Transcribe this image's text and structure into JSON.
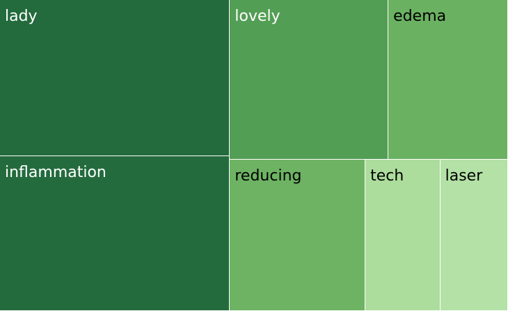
{
  "chart_data": {
    "type": "treemap",
    "title": "",
    "items": [
      {
        "label": "lady",
        "value": 16.8,
        "color": "#236b3d",
        "text_color": "#ffffff"
      },
      {
        "label": "inflammation",
        "value": 16.6,
        "color": "#236b3d",
        "text_color": "#ffffff"
      },
      {
        "label": "lovely",
        "value": 11.8,
        "color": "#539e55",
        "text_color": "#ffffff"
      },
      {
        "label": "edema",
        "value": 8.9,
        "color": "#6bb162",
        "text_color": "#000000"
      },
      {
        "label": "reducing",
        "value": 9.6,
        "color": "#6db363",
        "text_color": "#000000"
      },
      {
        "label": "tech",
        "value": 5.3,
        "color": "#acdd9c",
        "text_color": "#000000"
      },
      {
        "label": "laser",
        "value": 4.8,
        "color": "#b3e1a6",
        "text_color": "#000000"
      }
    ]
  }
}
